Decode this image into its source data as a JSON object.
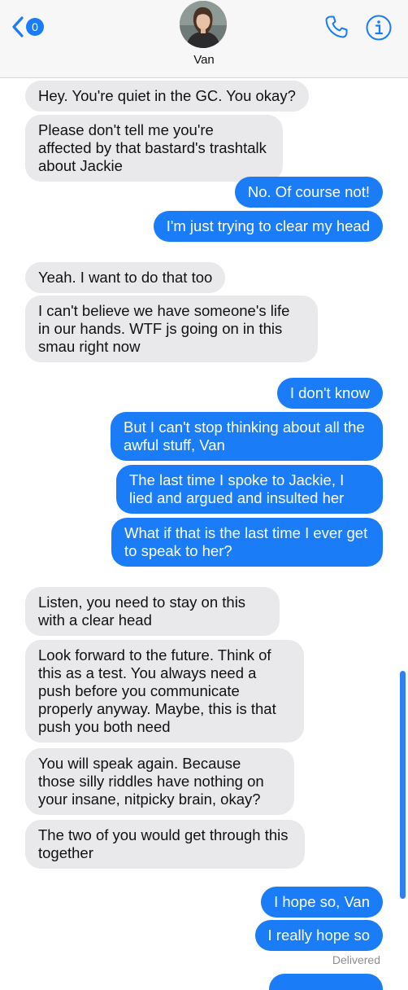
{
  "header": {
    "back_count": "0",
    "contact_name": "Van"
  },
  "messages": [
    {
      "dir": "in",
      "text": "Hey. You're quiet in the GC. You okay?"
    },
    {
      "dir": "in",
      "text": "Please don't tell me you're affected by that bastard's trashtalk about Jackie"
    },
    {
      "dir": "out",
      "text": "No. Of course not!"
    },
    {
      "dir": "out",
      "text": "I'm just trying to clear my head"
    },
    {
      "dir": "in",
      "text": "Yeah. I want to do that too"
    },
    {
      "dir": "in",
      "text": "I can't believe we have someone's life in our hands. WTF js going on in this smau right now"
    },
    {
      "dir": "out",
      "text": "I don't know"
    },
    {
      "dir": "out",
      "text": "But I can't stop thinking about all the awful stuff, Van"
    },
    {
      "dir": "out",
      "text": "The last time I spoke to Jackie, I lied and argued and insulted her"
    },
    {
      "dir": "out",
      "text": "What if that is the last time I ever get to speak to her?"
    },
    {
      "dir": "in",
      "text": "Listen, you need to stay on this with a clear head"
    },
    {
      "dir": "in",
      "text": "Look forward to the future. Think of this as a test. You always need a push before you communicate properly anyway. Maybe, this is that push you both need"
    },
    {
      "dir": "in",
      "text": "You will speak again. Because those silly riddles have nothing on your insane, nitpicky brain, okay?"
    },
    {
      "dir": "in",
      "text": "The two of you would get through this together"
    },
    {
      "dir": "out",
      "text": "I hope so, Van"
    },
    {
      "dir": "out",
      "text": "I really hope so"
    }
  ],
  "status": {
    "delivered": "Delivered"
  },
  "colors": {
    "accent": "#1a7cf6",
    "incoming_bubble": "#e9e9eb",
    "header_bg": "#f7f7f8"
  },
  "icons": [
    "back-chevron-icon",
    "phone-icon",
    "info-icon"
  ]
}
